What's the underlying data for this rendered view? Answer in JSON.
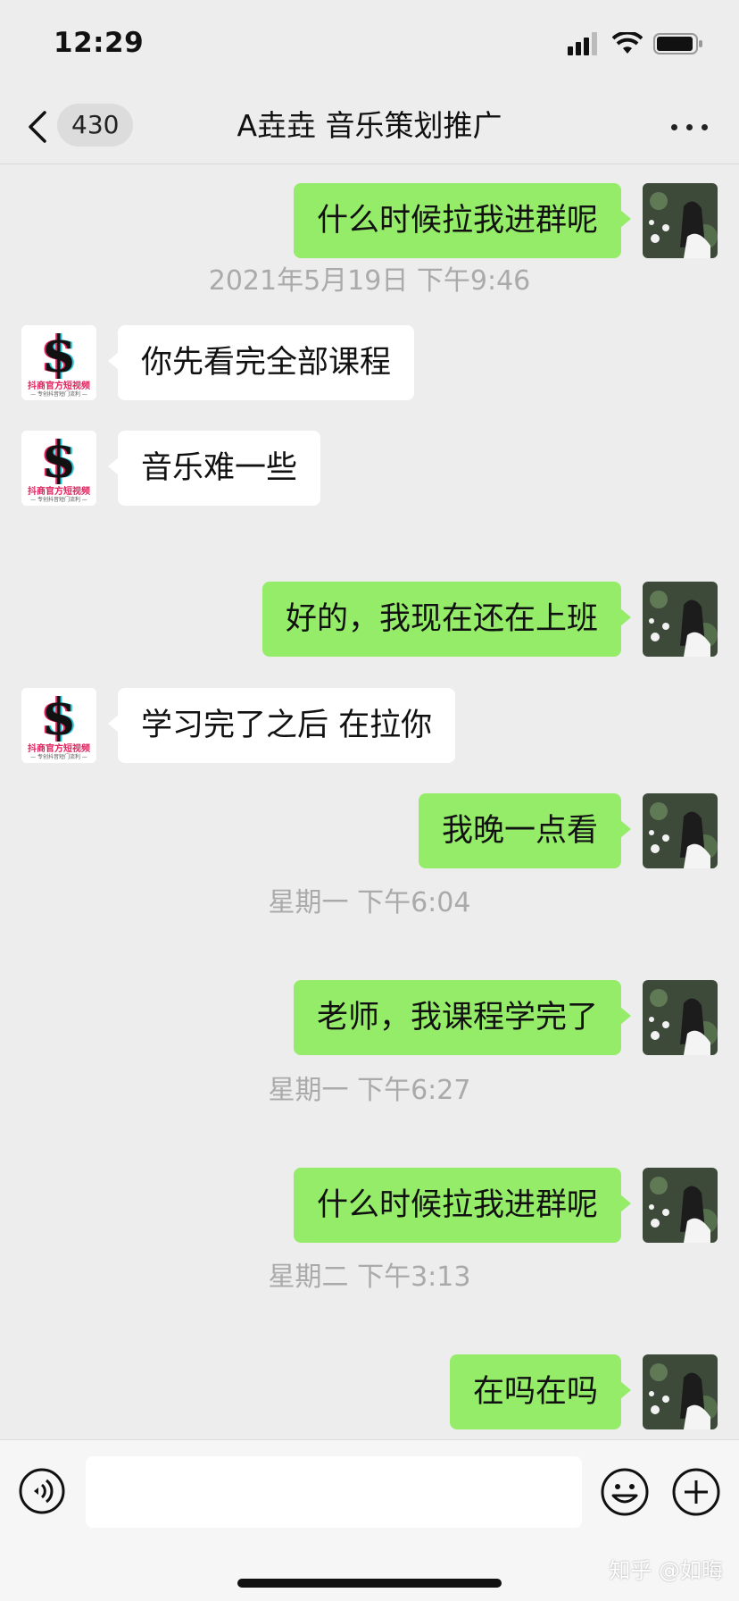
{
  "status_bar": {
    "time": "12:29"
  },
  "nav": {
    "unread_count": "430",
    "title": "A垚垚 音乐策划推广"
  },
  "contact_logo": {
    "symbol": "$",
    "caption": "抖商官方短视频",
    "subcaption": "— 专创抖音短门流利 —"
  },
  "messages": [
    {
      "side": "out",
      "text": "什么时候拉我进群呢"
    },
    {
      "type": "time",
      "text": "2021年5月19日 下午9:46"
    },
    {
      "side": "in",
      "text": "你先看完全部课程"
    },
    {
      "side": "in",
      "text": "音乐难一些"
    },
    {
      "side": "out",
      "text": "好的，我现在还在上班"
    },
    {
      "side": "in",
      "text": "学习完了之后 在拉你"
    },
    {
      "side": "out",
      "text": "我晚一点看"
    },
    {
      "type": "time",
      "text": "星期一 下午6:04"
    },
    {
      "side": "out",
      "text": "老师，我课程学完了"
    },
    {
      "type": "time",
      "text": "星期一 下午6:27"
    },
    {
      "side": "out",
      "text": "什么时候拉我进群呢"
    },
    {
      "type": "time",
      "text": "星期二 下午3:13"
    },
    {
      "side": "out",
      "text": "在吗在吗"
    }
  ],
  "input": {
    "value": "",
    "placeholder": ""
  },
  "icons": {
    "back": "chevron-left-icon",
    "more": "more-horizontal-icon",
    "voice": "voice-icon",
    "emoji": "emoji-icon",
    "plus": "plus-circle-icon"
  },
  "colors": {
    "background": "#ededed",
    "outgoing_bubble": "#95ec69",
    "incoming_bubble": "#ffffff",
    "timestamp": "#aaaaaa"
  },
  "watermark": "知乎 @如晦"
}
